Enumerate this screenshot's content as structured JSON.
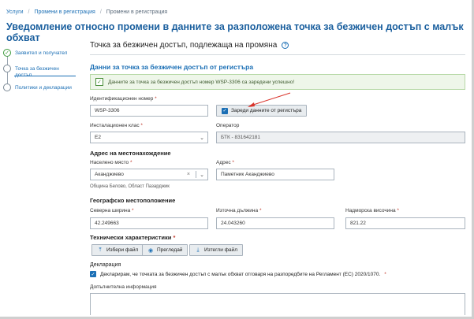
{
  "breadcrumb": [
    "Услуги",
    "Промени в регистрация",
    "Промени в регистрация"
  ],
  "page_title": "Уведомление относно промени в данните за разположена точка за безжичен достъп с малък обхват",
  "sidebar": {
    "steps": [
      {
        "label": "Заявител и получател",
        "state": "done"
      },
      {
        "label": "Точка за безжичен достъп",
        "state": "active"
      },
      {
        "label": "Политики и декларации",
        "state": "pending"
      }
    ]
  },
  "section": {
    "title": "Точка за безжичен достъп, подлежаща на промяна",
    "subtitle": "Данни за точка за безжичен достъп от регистъра",
    "alert": "Данните за точка за безжичен достъп номер WSP-3306 са заредени успешно!"
  },
  "fields": {
    "id_label": "Идентификационен номер",
    "id_value": "WSP-3306",
    "load_button": "Зареди данните от регистъра",
    "install_class_label": "Инсталационен клас",
    "install_class_value": "E2",
    "operator_label": "Оператор",
    "operator_value": "БТК - 831642181",
    "address_group": "Адрес на местонахождение",
    "settlement_label": "Населено място",
    "settlement_value": "Аканджиево",
    "settlement_hint": "Община Белово, Област Пазарджик",
    "address_label": "Адрес",
    "address_value": "Паметник Аканджиево",
    "geo_group": "Географско местоположение",
    "lat_label": "Северна ширина",
    "lat_value": "42.249663",
    "lon_label": "Източна дължина",
    "lon_value": "24.043260",
    "alt_label": "Надморска височина",
    "alt_value": "821.22",
    "tech_group": "Технически характеристики",
    "choose_file": "Избери файл",
    "preview": "Прегледай",
    "download_file": "Изтегли файл",
    "declaration_title": "Декларация",
    "declaration_text": "Декларирам, че точката за безжичен достъп с малък обхват отговаря на разпоредбите на Регламент (ЕС) 2020/1070.",
    "additional_info": "Допълнителна информация"
  },
  "colors": {
    "accent": "#1b6fb5",
    "title": "#1a5f9e",
    "success_bg": "#eef6e9",
    "arrow": "#d9342b"
  }
}
